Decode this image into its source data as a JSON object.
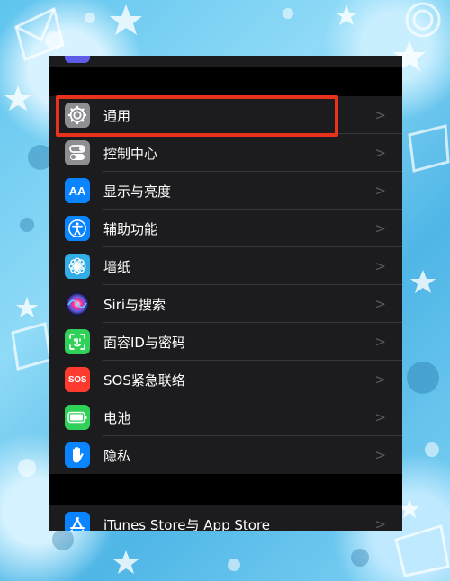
{
  "settings": {
    "rows": [
      {
        "label": "通用",
        "icon": "gear-icon",
        "color": "#8e8e93"
      },
      {
        "label": "控制中心",
        "icon": "toggles-icon",
        "color": "#8e8e93"
      },
      {
        "label": "显示与亮度",
        "icon": "text-size-icon",
        "icon_text": "AA",
        "color": "#0a84ff"
      },
      {
        "label": "辅助功能",
        "icon": "accessibility-icon",
        "color": "#0a84ff"
      },
      {
        "label": "墙纸",
        "icon": "flower-icon",
        "color": "#32ade6"
      },
      {
        "label": "Siri与搜索",
        "icon": "siri-icon",
        "color": "#1c1c1e"
      },
      {
        "label": "面容ID与密码",
        "icon": "face-id-icon",
        "color": "#30d158"
      },
      {
        "label": "SOS紧急联络",
        "icon": "sos-icon",
        "icon_text": "SOS",
        "color": "#ff3b30"
      },
      {
        "label": "电池",
        "icon": "battery-icon",
        "color": "#30d158"
      },
      {
        "label": "隐私",
        "icon": "hand-icon",
        "color": "#0a84ff"
      }
    ],
    "second_group": [
      {
        "label": "iTunes Store与 App Store",
        "icon": "app-store-icon",
        "color": "#0a84ff"
      }
    ],
    "chevron": ">"
  },
  "colors": {
    "highlight_box": "#e8321e",
    "background": "#000000",
    "cell": "#1c1c1e"
  }
}
